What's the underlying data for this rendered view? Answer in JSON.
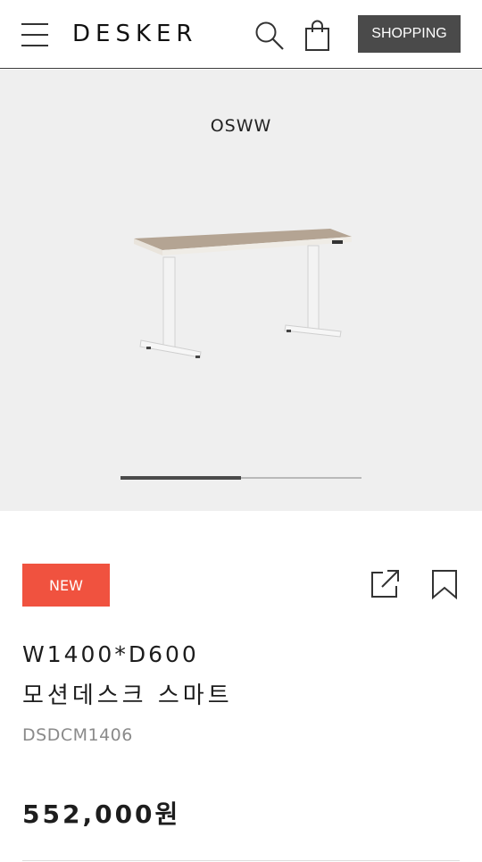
{
  "header": {
    "logo": "DESKER",
    "shopping_label": "SHOPPING"
  },
  "hero": {
    "color_name": "OSWW",
    "slider_progress": 0.5
  },
  "product": {
    "badge": "NEW",
    "size": "W1400*D600",
    "name": "모션데스크 스마트",
    "code": "DSDCM1406",
    "price": "552,000원"
  },
  "colors": {
    "badge_bg": "#f0523f",
    "shopping_bg": "#4a4a4a",
    "hero_bg": "#efefef",
    "desk_top": "#b4a493",
    "desk_frame": "#f4f4f4"
  },
  "icons": [
    "menu-icon",
    "search-icon",
    "shopping-bag-icon",
    "share-icon",
    "bookmark-icon"
  ]
}
